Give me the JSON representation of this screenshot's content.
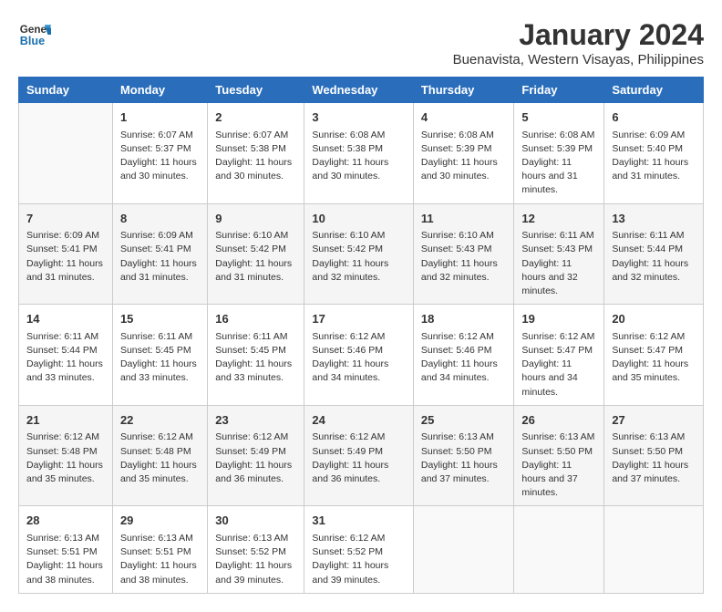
{
  "header": {
    "logo_line1": "General",
    "logo_line2": "Blue",
    "title": "January 2024",
    "subtitle": "Buenavista, Western Visayas, Philippines"
  },
  "calendar": {
    "days_of_week": [
      "Sunday",
      "Monday",
      "Tuesday",
      "Wednesday",
      "Thursday",
      "Friday",
      "Saturday"
    ],
    "weeks": [
      [
        {
          "day": "",
          "sunrise": "",
          "sunset": "",
          "daylight": ""
        },
        {
          "day": "1",
          "sunrise": "Sunrise: 6:07 AM",
          "sunset": "Sunset: 5:37 PM",
          "daylight": "Daylight: 11 hours and 30 minutes."
        },
        {
          "day": "2",
          "sunrise": "Sunrise: 6:07 AM",
          "sunset": "Sunset: 5:38 PM",
          "daylight": "Daylight: 11 hours and 30 minutes."
        },
        {
          "day": "3",
          "sunrise": "Sunrise: 6:08 AM",
          "sunset": "Sunset: 5:38 PM",
          "daylight": "Daylight: 11 hours and 30 minutes."
        },
        {
          "day": "4",
          "sunrise": "Sunrise: 6:08 AM",
          "sunset": "Sunset: 5:39 PM",
          "daylight": "Daylight: 11 hours and 30 minutes."
        },
        {
          "day": "5",
          "sunrise": "Sunrise: 6:08 AM",
          "sunset": "Sunset: 5:39 PM",
          "daylight": "Daylight: 11 hours and 31 minutes."
        },
        {
          "day": "6",
          "sunrise": "Sunrise: 6:09 AM",
          "sunset": "Sunset: 5:40 PM",
          "daylight": "Daylight: 11 hours and 31 minutes."
        }
      ],
      [
        {
          "day": "7",
          "sunrise": "Sunrise: 6:09 AM",
          "sunset": "Sunset: 5:41 PM",
          "daylight": "Daylight: 11 hours and 31 minutes."
        },
        {
          "day": "8",
          "sunrise": "Sunrise: 6:09 AM",
          "sunset": "Sunset: 5:41 PM",
          "daylight": "Daylight: 11 hours and 31 minutes."
        },
        {
          "day": "9",
          "sunrise": "Sunrise: 6:10 AM",
          "sunset": "Sunset: 5:42 PM",
          "daylight": "Daylight: 11 hours and 31 minutes."
        },
        {
          "day": "10",
          "sunrise": "Sunrise: 6:10 AM",
          "sunset": "Sunset: 5:42 PM",
          "daylight": "Daylight: 11 hours and 32 minutes."
        },
        {
          "day": "11",
          "sunrise": "Sunrise: 6:10 AM",
          "sunset": "Sunset: 5:43 PM",
          "daylight": "Daylight: 11 hours and 32 minutes."
        },
        {
          "day": "12",
          "sunrise": "Sunrise: 6:11 AM",
          "sunset": "Sunset: 5:43 PM",
          "daylight": "Daylight: 11 hours and 32 minutes."
        },
        {
          "day": "13",
          "sunrise": "Sunrise: 6:11 AM",
          "sunset": "Sunset: 5:44 PM",
          "daylight": "Daylight: 11 hours and 32 minutes."
        }
      ],
      [
        {
          "day": "14",
          "sunrise": "Sunrise: 6:11 AM",
          "sunset": "Sunset: 5:44 PM",
          "daylight": "Daylight: 11 hours and 33 minutes."
        },
        {
          "day": "15",
          "sunrise": "Sunrise: 6:11 AM",
          "sunset": "Sunset: 5:45 PM",
          "daylight": "Daylight: 11 hours and 33 minutes."
        },
        {
          "day": "16",
          "sunrise": "Sunrise: 6:11 AM",
          "sunset": "Sunset: 5:45 PM",
          "daylight": "Daylight: 11 hours and 33 minutes."
        },
        {
          "day": "17",
          "sunrise": "Sunrise: 6:12 AM",
          "sunset": "Sunset: 5:46 PM",
          "daylight": "Daylight: 11 hours and 34 minutes."
        },
        {
          "day": "18",
          "sunrise": "Sunrise: 6:12 AM",
          "sunset": "Sunset: 5:46 PM",
          "daylight": "Daylight: 11 hours and 34 minutes."
        },
        {
          "day": "19",
          "sunrise": "Sunrise: 6:12 AM",
          "sunset": "Sunset: 5:47 PM",
          "daylight": "Daylight: 11 hours and 34 minutes."
        },
        {
          "day": "20",
          "sunrise": "Sunrise: 6:12 AM",
          "sunset": "Sunset: 5:47 PM",
          "daylight": "Daylight: 11 hours and 35 minutes."
        }
      ],
      [
        {
          "day": "21",
          "sunrise": "Sunrise: 6:12 AM",
          "sunset": "Sunset: 5:48 PM",
          "daylight": "Daylight: 11 hours and 35 minutes."
        },
        {
          "day": "22",
          "sunrise": "Sunrise: 6:12 AM",
          "sunset": "Sunset: 5:48 PM",
          "daylight": "Daylight: 11 hours and 35 minutes."
        },
        {
          "day": "23",
          "sunrise": "Sunrise: 6:12 AM",
          "sunset": "Sunset: 5:49 PM",
          "daylight": "Daylight: 11 hours and 36 minutes."
        },
        {
          "day": "24",
          "sunrise": "Sunrise: 6:12 AM",
          "sunset": "Sunset: 5:49 PM",
          "daylight": "Daylight: 11 hours and 36 minutes."
        },
        {
          "day": "25",
          "sunrise": "Sunrise: 6:13 AM",
          "sunset": "Sunset: 5:50 PM",
          "daylight": "Daylight: 11 hours and 37 minutes."
        },
        {
          "day": "26",
          "sunrise": "Sunrise: 6:13 AM",
          "sunset": "Sunset: 5:50 PM",
          "daylight": "Daylight: 11 hours and 37 minutes."
        },
        {
          "day": "27",
          "sunrise": "Sunrise: 6:13 AM",
          "sunset": "Sunset: 5:50 PM",
          "daylight": "Daylight: 11 hours and 37 minutes."
        }
      ],
      [
        {
          "day": "28",
          "sunrise": "Sunrise: 6:13 AM",
          "sunset": "Sunset: 5:51 PM",
          "daylight": "Daylight: 11 hours and 38 minutes."
        },
        {
          "day": "29",
          "sunrise": "Sunrise: 6:13 AM",
          "sunset": "Sunset: 5:51 PM",
          "daylight": "Daylight: 11 hours and 38 minutes."
        },
        {
          "day": "30",
          "sunrise": "Sunrise: 6:13 AM",
          "sunset": "Sunset: 5:52 PM",
          "daylight": "Daylight: 11 hours and 39 minutes."
        },
        {
          "day": "31",
          "sunrise": "Sunrise: 6:12 AM",
          "sunset": "Sunset: 5:52 PM",
          "daylight": "Daylight: 11 hours and 39 minutes."
        },
        {
          "day": "",
          "sunrise": "",
          "sunset": "",
          "daylight": ""
        },
        {
          "day": "",
          "sunrise": "",
          "sunset": "",
          "daylight": ""
        },
        {
          "day": "",
          "sunrise": "",
          "sunset": "",
          "daylight": ""
        }
      ]
    ]
  }
}
